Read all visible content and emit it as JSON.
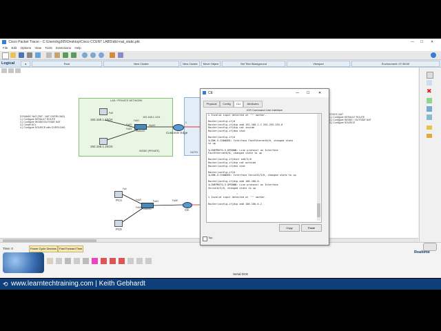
{
  "app": {
    "title": "Cisco Packet Tracer - C:\\Users\\kg365\\Desktop\\Cisco CCENT LABS\\dtcl-nat_static.pkt",
    "menu": [
      "File",
      "Edit",
      "Options",
      "View",
      "Tools",
      "Extensions",
      "Help"
    ]
  },
  "logical_bar": {
    "mode": "Logical",
    "root": "Root",
    "new_cluster": "New Cluster",
    "move_object": "Move Object",
    "set_tiled_bg": "Set Tiled Background",
    "viewport": "Viewport",
    "environment": "Environment: 07:38:00"
  },
  "canvas": {
    "lan_title": "LAN / PRIVATE NETWORK",
    "pc_top": "Fa0",
    "ip1": "192.168.1.10/24",
    "ip2": "192.168.1.20/24",
    "gw_ip": "192.168.1.1/24",
    "switch0": "Switch0",
    "inside_label": "INSIDE (PRIVATE)",
    "router_name": "Customer Edge",
    "router_port_g0": "Gig0/0",
    "router_port_s": "0",
    "fa01": "Fa0/1",
    "fa02": "Fa0/2",
    "fa03": "Fa0/3",
    "outside_label": "OUTSI",
    "dyn_nat_title": "DYNAMIC NAT (PAT - NAT OVERLOAD)",
    "dyn_nat_steps": [
      "1.) Configure DEFAULT ROUTE",
      "2.) Configure INSIDE/OUTSIDE NAT",
      "3.) Create ACL",
      "4.) Configure SOURCE with OVERLOAD"
    ],
    "static_nat_title": "STATIC NAT",
    "static_nat_steps": [
      "1.) Configure DEFAULT ROUTE",
      "2.) Configure INSIDE / OUTSIDE NAT",
      "3.) Configure SOURCE"
    ],
    "pc4": "PC4",
    "pc5": "PC5",
    "switch2": "Switch2",
    "ce": "CE",
    "fa0": "Fa0",
    "fa02b": "Fa0/2",
    "fa03b": "Fa0/3",
    "fa01b": "Fa0/1",
    "fa00": "Fa0/0",
    "fa02c": "Fa0/2"
  },
  "dialog": {
    "title": "CE",
    "tabs": [
      "Physical",
      "Config",
      "CLI",
      "Attributes"
    ],
    "active_tab": "CLI",
    "section": "IOS Command Line Interface",
    "terminal": [
      "% Invalid input detected at '^' marker.",
      "",
      "Router(config-if)#",
      "Router(config-if)#ip add 192.168.1.1 255.255.255.0",
      "Router(config-if)#ip nat inside",
      "Router(config-if)#no shut",
      "",
      "Router(config-if)#",
      "%LINK-5-CHANGED: Interface FastEthernet0/0, changed state",
      "to up",
      "",
      "%LINEPROTO-5-UPDOWN: Line protocol on Interface",
      "FastEthernet0/0, changed state to up",
      "",
      "Router(config-if)#int se0/3/0",
      "Router(config-if)#ip nat outside",
      "Router(config-if)#no shut",
      "",
      "Router(config-if)#",
      "%LINK-5-CHANGED: Interface Serial0/3/0, changed state to up",
      "",
      "Router(config-if)#ip add 100.100.0.",
      "%LINEPROTO-5-UPDOWN: Line protocol on Interface",
      "Serial0/3/0, changed state to up",
      "",
      "                   ^",
      "% Invalid input detected at '^' marker.",
      "",
      "Router(config-if)#ip add 100.100.0.2"
    ],
    "copy": "Copy",
    "paste": "Paste",
    "top_checkbox": "Top"
  },
  "bottom": {
    "time": "Time: 0",
    "power_cycle": "Power Cycle Devices",
    "fast_forward": "Fast Forward Time",
    "realtime": "Realtime",
    "serial": "Serial DCE"
  },
  "footer": {
    "text": "www.learntechtraining.com | Keith Gebhardt"
  },
  "colors": {
    "footer_bg": "#0f3f7a",
    "lan_box": "#eaf6e4",
    "outside_box": "#e3eef9",
    "link_red": "#d33"
  }
}
